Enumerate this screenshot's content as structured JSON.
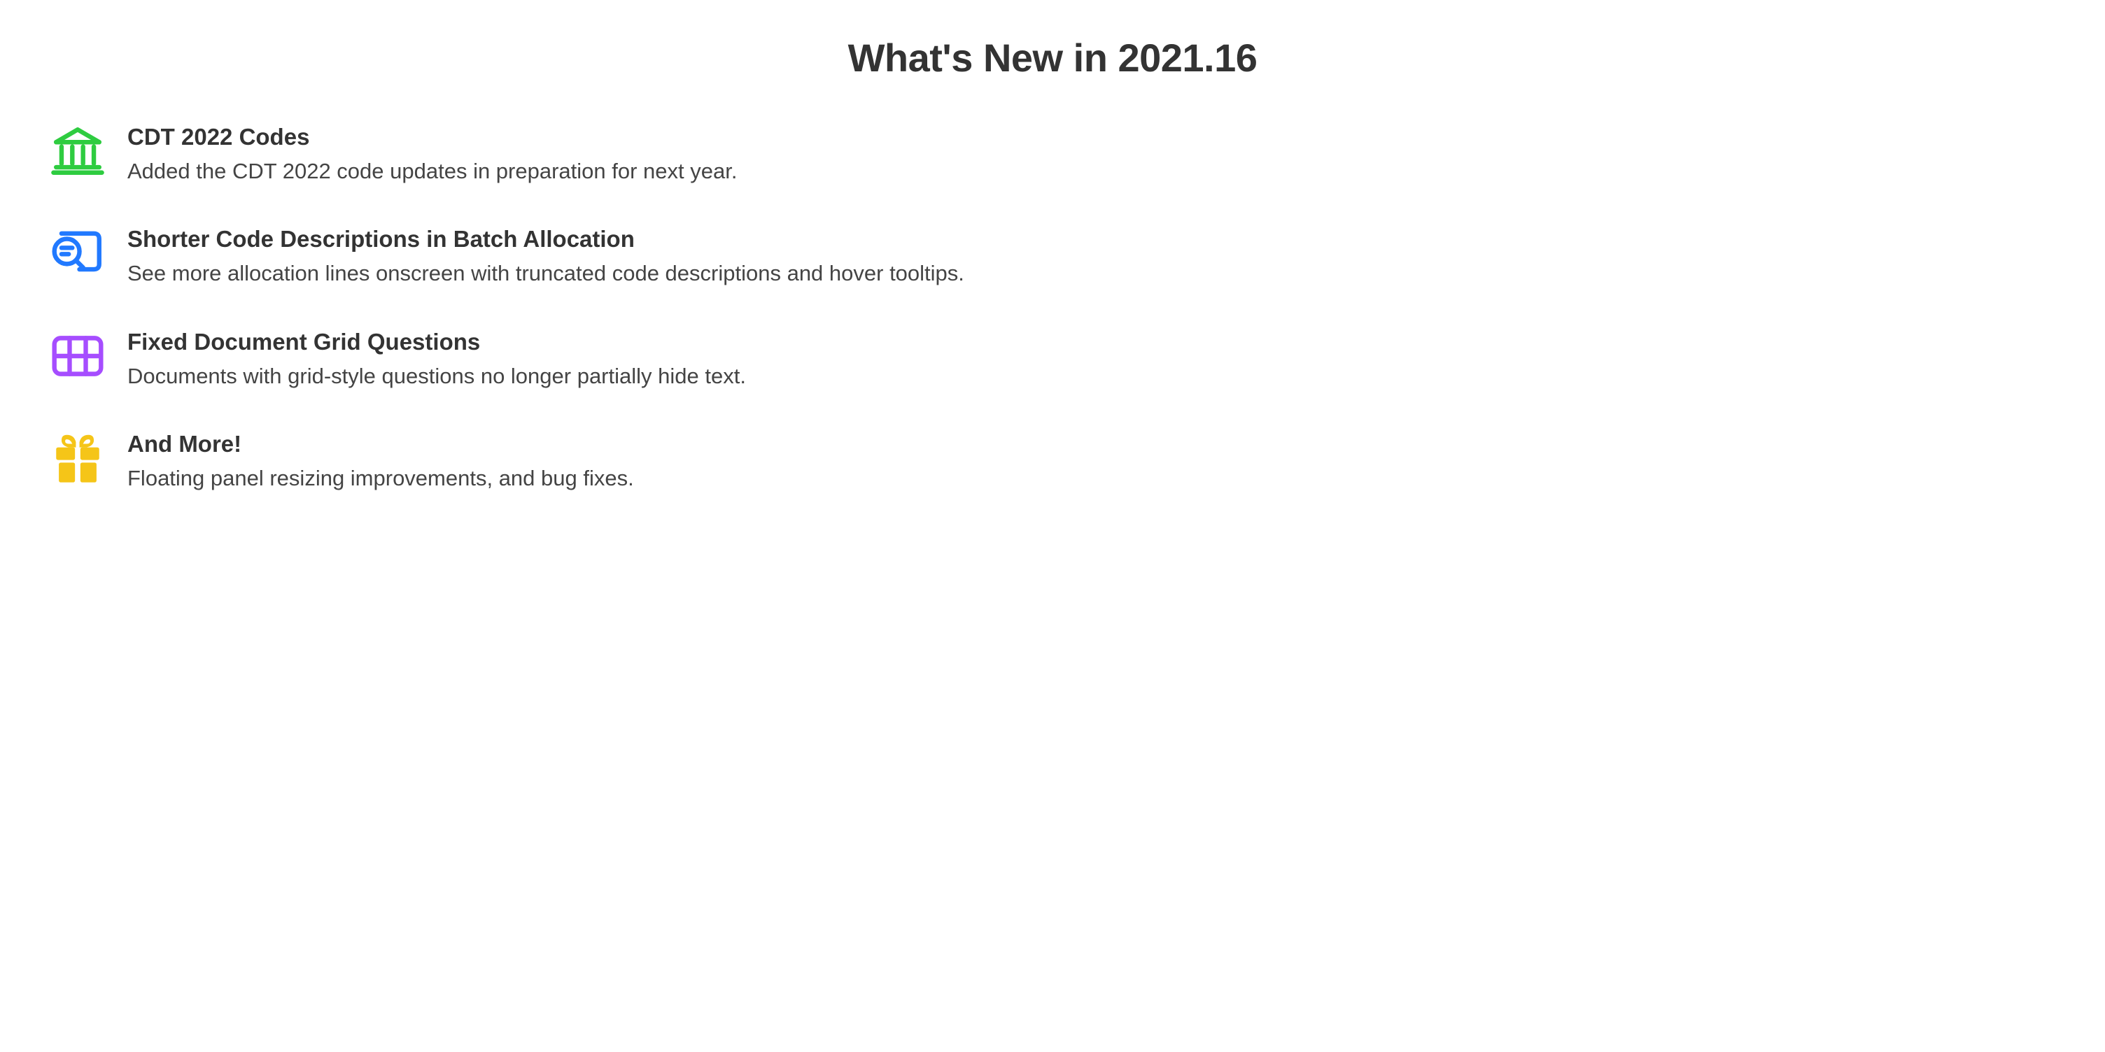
{
  "title": "What's New in 2021.16",
  "features": [
    {
      "icon": "bank-icon",
      "color": "#2ecc40",
      "title": "CDT 2022 Codes",
      "description": "Added the CDT 2022 code updates in preparation for next year."
    },
    {
      "icon": "search-doc-icon",
      "color": "#2179ff",
      "title": "Shorter Code Descriptions in Batch Allocation",
      "description": "See more allocation lines onscreen with truncated code descriptions and hover tooltips."
    },
    {
      "icon": "grid-icon",
      "color": "#a64dff",
      "title": "Fixed Document Grid Questions",
      "description": "Documents with grid-style questions no longer partially hide text."
    },
    {
      "icon": "gift-icon",
      "color": "#f5c518",
      "title": "And More!",
      "description": "Floating panel resizing improvements, and bug fixes."
    }
  ]
}
